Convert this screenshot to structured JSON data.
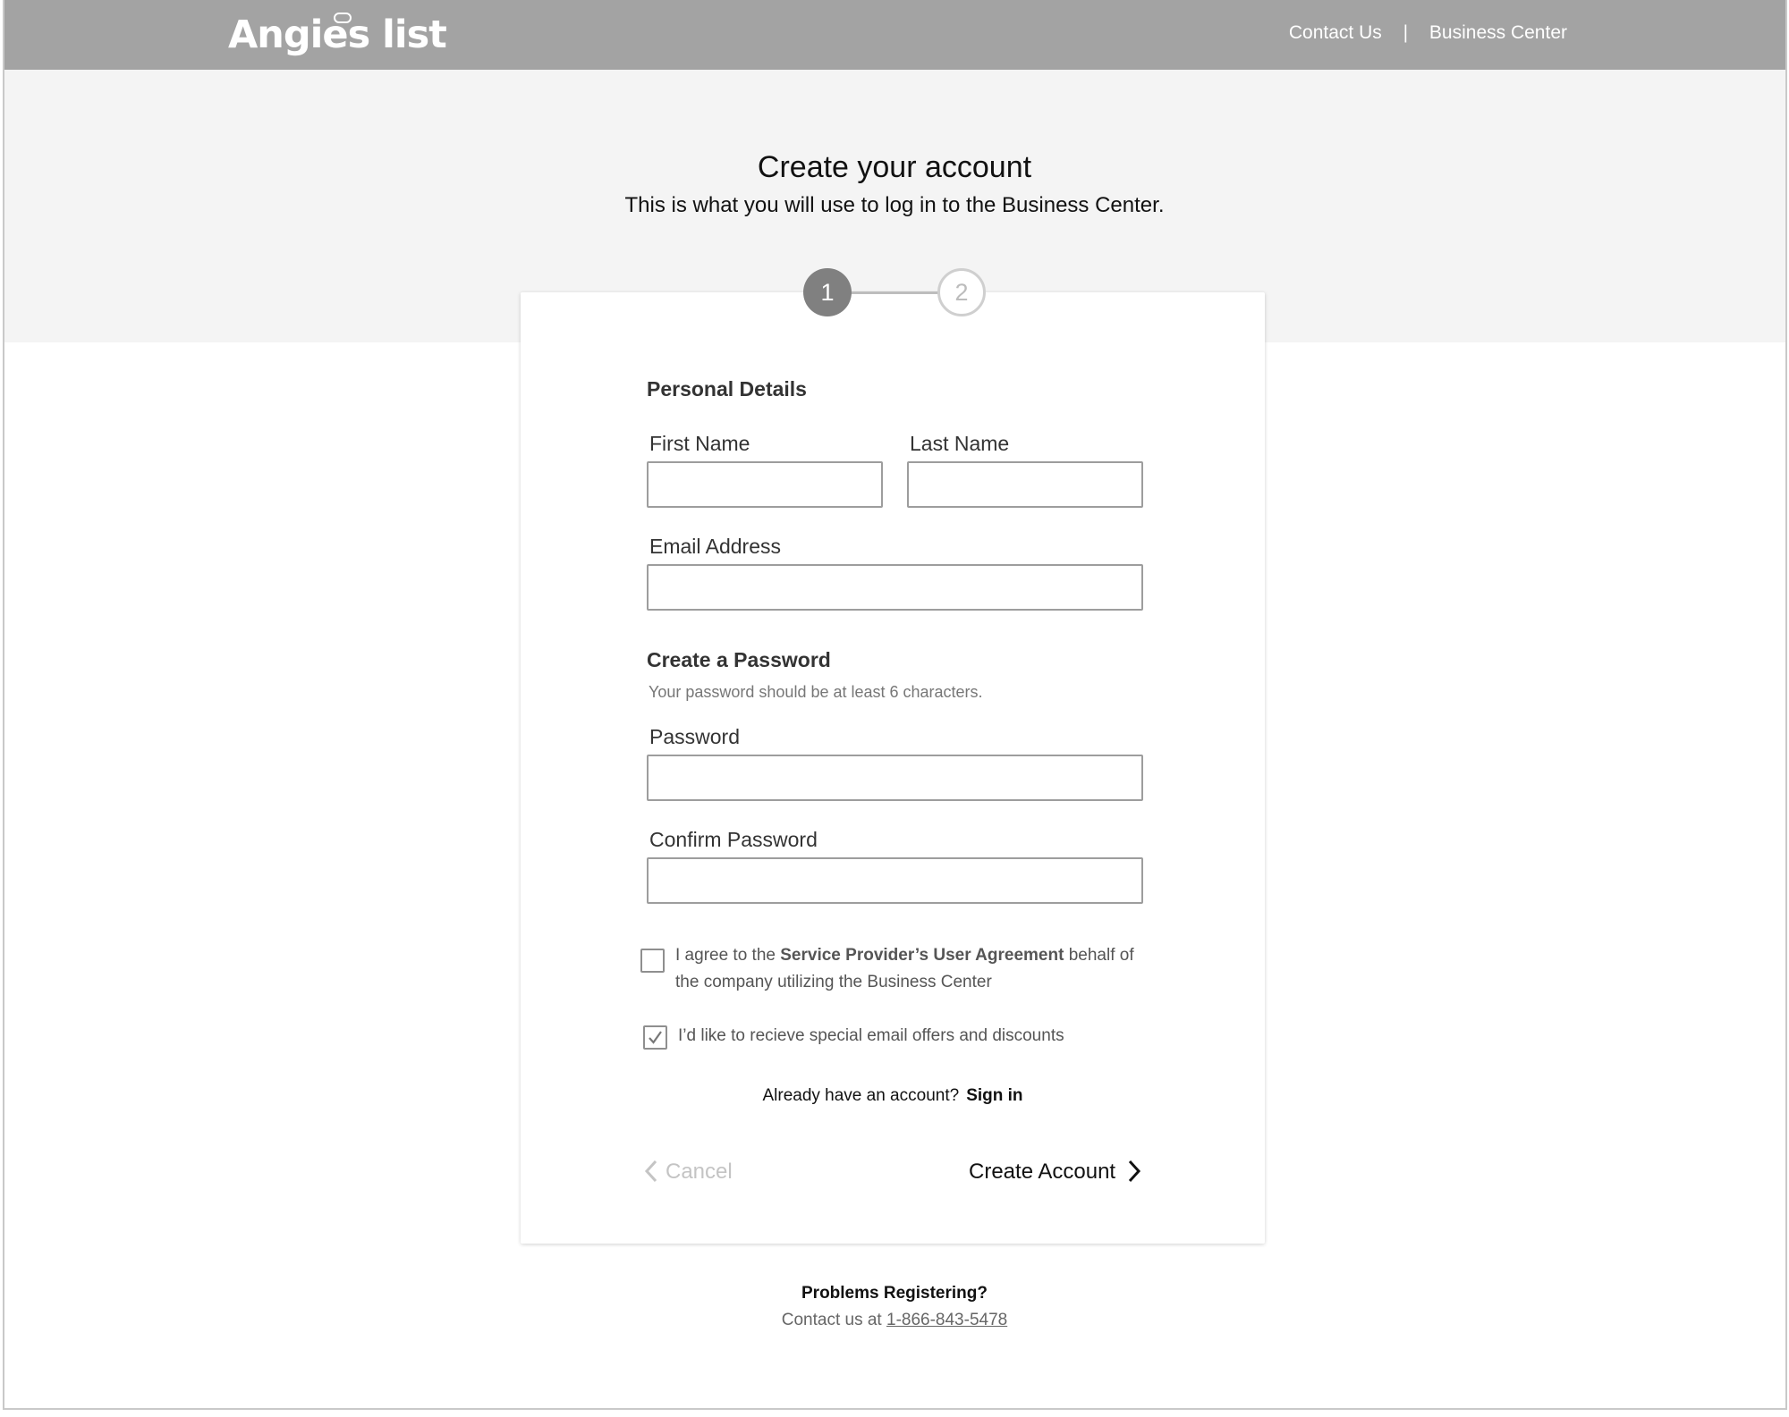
{
  "header": {
    "logo_text": "Angies list",
    "nav": {
      "contact_us": "Contact Us",
      "separator": "|",
      "business_center": "Business Center"
    }
  },
  "intro": {
    "title": "Create your account",
    "subtitle": "This is what you will use to log in to the Business Center."
  },
  "stepper": {
    "step1": "1",
    "step2": "2",
    "current": 1
  },
  "form": {
    "personal_heading": "Personal Details",
    "first_name_label": "First Name",
    "first_name_value": "",
    "last_name_label": "Last Name",
    "last_name_value": "",
    "email_label": "Email Address",
    "email_value": "",
    "password_heading": "Create a Password",
    "password_hint": "Your password should be at least 6 characters.",
    "password_label": "Password",
    "confirm_label": "Confirm Password",
    "agreement": {
      "prefix": "I agree to the ",
      "link": "Service Provider’s User Agreement",
      "suffix": " behalf of",
      "line2": "the company utilizing the Business Center",
      "checked": false
    },
    "offers": {
      "text": "I’d like to recieve special email offers and discounts",
      "checked": true
    },
    "signin_prompt": "Already have an account?",
    "signin_link": "Sign in",
    "cancel_label": "Cancel",
    "create_label": "Create Account"
  },
  "footer": {
    "problems": "Problems Registering?",
    "contact_prefix": "Contact us at ",
    "phone": "1-866-843-5478"
  },
  "colors": {
    "header_bg": "#a3a3a3",
    "hero_bg": "#f4f4f4",
    "step_active": "#808080"
  }
}
